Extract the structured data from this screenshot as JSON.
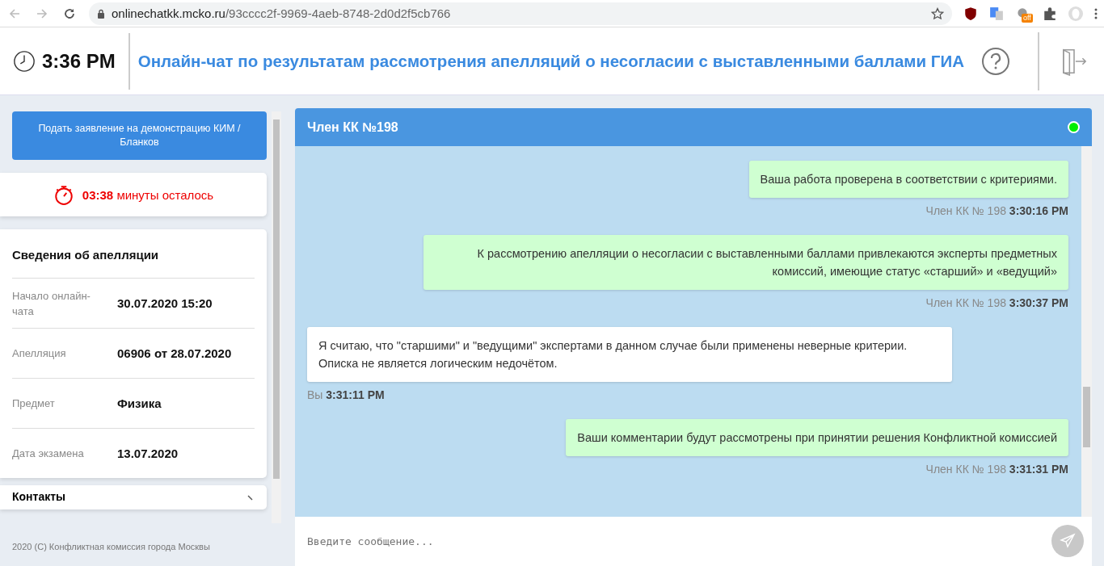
{
  "browser": {
    "url_host": "onlinechatkk.mcko.ru",
    "url_path": "/93cccc2f-9969-4aeb-8748-2d0d2f5cb766",
    "extension_badge": "off"
  },
  "header": {
    "time": "3:36 PM",
    "title": "Онлайн-чат по результатам рассмотрения апелляций о несогласии с выставленными баллами ГИА"
  },
  "sidebar": {
    "demo_button": "Подать заявление на демонстрацию КИМ / Бланков",
    "timer": {
      "time": "03:38",
      "label": "минуты осталось"
    },
    "info": {
      "title": "Сведения об апелляции",
      "rows": [
        {
          "label": "Начало онлайн-чата",
          "value": "30.07.2020 15:20"
        },
        {
          "label": "Апелляция",
          "value": "06906 от 28.07.2020"
        },
        {
          "label": "Предмет",
          "value": "Физика"
        },
        {
          "label": "Дата экзамена",
          "value": "13.07.2020"
        }
      ]
    },
    "contacts": "Контакты",
    "footer": "2020 (С) Конфликтная комиссия города Москвы"
  },
  "chat": {
    "title": "Член КК №198",
    "status_dot": {
      "color": "#00ee00"
    },
    "messages": [
      {
        "kind": "incoming",
        "text": "Ваша работа проверена в соответствии с критериями.",
        "author": "Член КК № 198",
        "time": "3:30:16 PM"
      },
      {
        "kind": "incoming",
        "text": "К рассмотрению апелляции о несогласии с выставленными баллами привлекаются эксперты предметных комиссий, имеющие статус «старший» и «ведущий»",
        "author": "Член КК № 198",
        "time": "3:30:37 PM"
      },
      {
        "kind": "outgoing",
        "text": "Я считаю, что \"старшими\" и \"ведущими\" экспертами в данном случае были применены неверные критерии. Описка не является логическим недочётом.",
        "author": "Вы",
        "time": "3:31:11 PM"
      },
      {
        "kind": "incoming",
        "text": "Ваши комментарии будут рассмотрены при принятии решения Конфликтной комиссией",
        "author": "Член КК № 198",
        "time": "3:31:31 PM"
      }
    ],
    "input_placeholder": "Введите сообщение..."
  }
}
